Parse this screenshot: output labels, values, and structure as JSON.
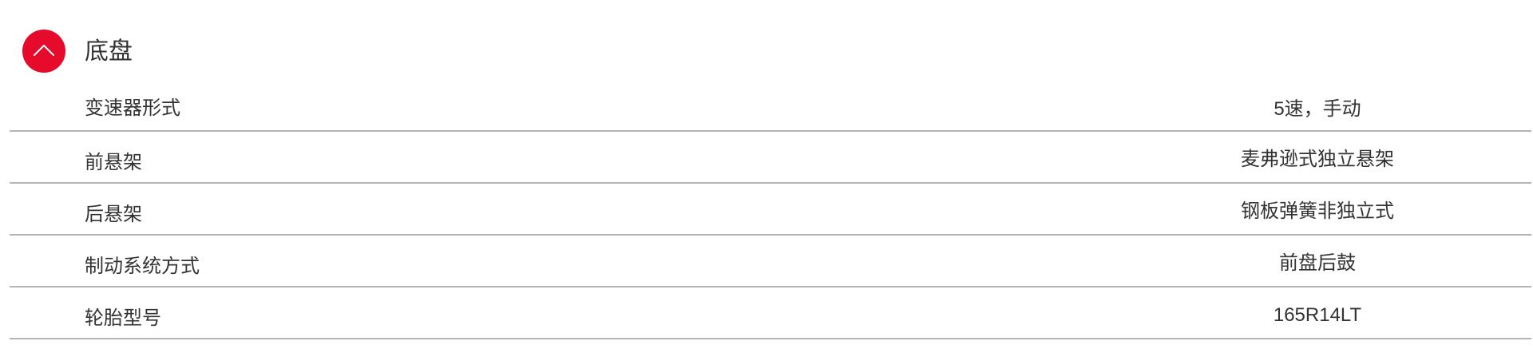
{
  "section": {
    "title": "底盘",
    "toggle_icon": "chevron-up-icon",
    "accent_color": "#e60a2b"
  },
  "specs": [
    {
      "label": "变速器形式",
      "value": "5速，手动"
    },
    {
      "label": "前悬架",
      "value": "麦弗逊式独立悬架"
    },
    {
      "label": "后悬架",
      "value": "钢板弹簧非独立式"
    },
    {
      "label": "制动系统方式",
      "value": "前盘后鼓"
    },
    {
      "label": "轮胎型号",
      "value": "165R14LT"
    }
  ]
}
